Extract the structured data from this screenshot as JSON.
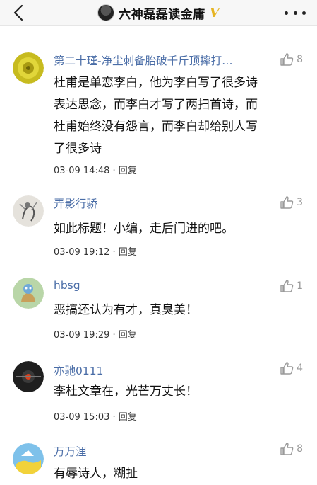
{
  "header": {
    "title": "六神磊磊读金庸",
    "badge": "V",
    "badge_color": "#e6b422",
    "back_icon": "chevron-left-icon",
    "more_icon": "more-dots-icon"
  },
  "comments": [
    {
      "name": "第二十瑾-净尘刺备胎破千斤顶摔打…",
      "likes": "8",
      "lines": [
        "杜甫是单恋李白，他为李白写了很多诗",
        "表达思念，而李白才写了两扫首诗，而",
        "杜甫始终没有怨言，而李白却给别人写",
        "了很多诗"
      ],
      "time": "03-09 14:48",
      "reply": "回复"
    },
    {
      "name": "弄影行骄",
      "likes": "3",
      "lines": [
        "如此标题！小编，走后门进的吧。"
      ],
      "time": "03-09 19:12",
      "reply": "回复"
    },
    {
      "name": "hbsg",
      "likes": "1",
      "lines": [
        "恶搞还认为有才，真臭美！"
      ],
      "time": "03-09 19:29",
      "reply": "回复"
    },
    {
      "name": "亦驰0111",
      "likes": "4",
      "lines": [
        "李杜文章在，光芒万丈长！"
      ],
      "time": "03-09 15:03",
      "reply": "回复"
    },
    {
      "name": "万万浬",
      "likes": "8",
      "lines": [
        "有辱诗人，糊扯"
      ],
      "time": "",
      "reply": ""
    }
  ],
  "colors": {
    "name": "#4a6da7",
    "like": "#9a9a9a"
  }
}
